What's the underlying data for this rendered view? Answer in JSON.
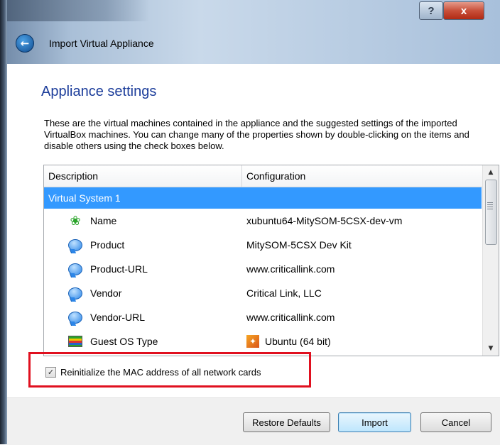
{
  "window": {
    "title": "Import Virtual Appliance",
    "help_label": "?",
    "close_label": "x"
  },
  "page": {
    "title": "Appliance settings",
    "description": "These are the virtual machines contained in the appliance and the suggested settings of the imported VirtualBox machines. You can change many of the properties shown by double-clicking on the items and disable others using the check boxes below."
  },
  "table": {
    "headers": [
      "Description",
      "Configuration"
    ],
    "group": "Virtual System 1",
    "rows": [
      {
        "label": "Name",
        "value": "xubuntu64-MitySOM-5CSX-dev-vm",
        "icon": "name-icon"
      },
      {
        "label": "Product",
        "value": "MitySOM-5CSX Dev Kit",
        "icon": "info-bubble-icon"
      },
      {
        "label": "Product-URL",
        "value": "www.criticallink.com",
        "icon": "info-bubble-icon"
      },
      {
        "label": "Vendor",
        "value": "Critical Link, LLC",
        "icon": "info-bubble-icon"
      },
      {
        "label": "Vendor-URL",
        "value": "www.criticallink.com",
        "icon": "info-bubble-icon"
      },
      {
        "label": "Guest OS Type",
        "value": "Ubuntu (64 bit)",
        "icon": "os-type-icon"
      }
    ]
  },
  "options": {
    "reinit_mac_label": "Reinitialize the MAC address of all network cards",
    "reinit_mac_checked": true
  },
  "buttons": {
    "restore": "Restore Defaults",
    "import": "Import",
    "cancel": "Cancel"
  },
  "colors": {
    "selection": "#3399ff",
    "highlight": "#e0101f",
    "title": "#1b3c9a"
  }
}
